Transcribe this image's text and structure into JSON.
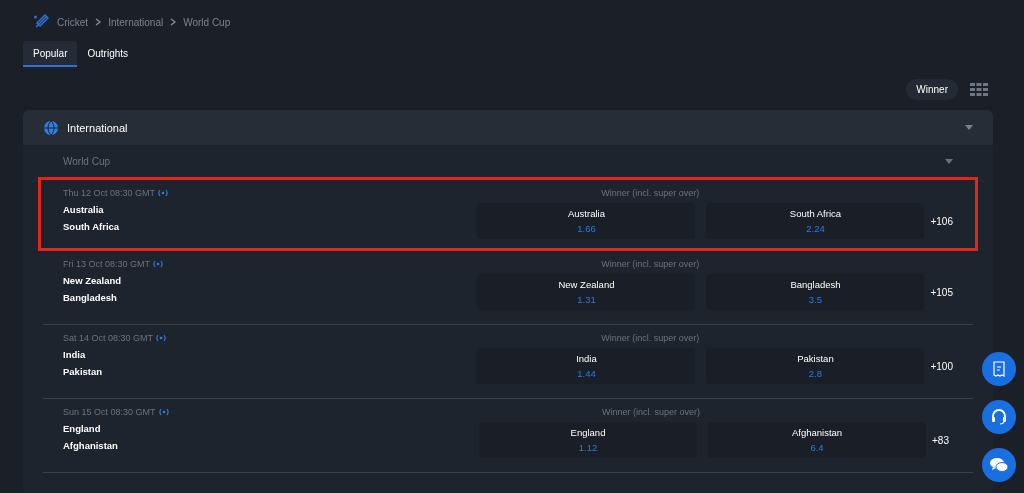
{
  "breadcrumb": [
    "Cricket",
    "International",
    "World Cup"
  ],
  "tabs": [
    {
      "label": "Popular",
      "selected": true
    },
    {
      "label": "Outrights",
      "selected": false
    }
  ],
  "market_selector": {
    "label": "Winner"
  },
  "section": {
    "title": "International",
    "expanded": true
  },
  "competition": {
    "title": "World Cup",
    "expanded": true
  },
  "matches": [
    {
      "time": "Thu 12 Oct 08:30 GMT",
      "live": true,
      "highlighted": true,
      "home": "Australia",
      "away": "South Africa",
      "market": "Winner (incl. super over)",
      "odds": [
        {
          "team": "Australia",
          "price": "1.66"
        },
        {
          "team": "South Africa",
          "price": "2.24"
        }
      ],
      "more": "+106"
    },
    {
      "time": "Fri 13 Oct 08:30 GMT",
      "live": true,
      "highlighted": false,
      "home": "New Zealand",
      "away": "Bangladesh",
      "market": "Winner (incl. super over)",
      "odds": [
        {
          "team": "New Zealand",
          "price": "1.31"
        },
        {
          "team": "Bangladesh",
          "price": "3.5"
        }
      ],
      "more": "+105"
    },
    {
      "time": "Sat 14 Oct 08:30 GMT",
      "live": true,
      "highlighted": false,
      "home": "India",
      "away": "Pakistan",
      "market": "Winner (incl. super over)",
      "odds": [
        {
          "team": "India",
          "price": "1.44"
        },
        {
          "team": "Pakistan",
          "price": "2.8"
        }
      ],
      "more": "+100"
    },
    {
      "time": "Sun 15 Oct 08:30 GMT",
      "live": true,
      "highlighted": false,
      "home": "England",
      "away": "Afghanistan",
      "market": "Winner (incl. super over)",
      "odds": [
        {
          "team": "England",
          "price": "1.12"
        },
        {
          "team": "Afghanistan",
          "price": "6.4"
        }
      ],
      "more": "+83"
    }
  ]
}
